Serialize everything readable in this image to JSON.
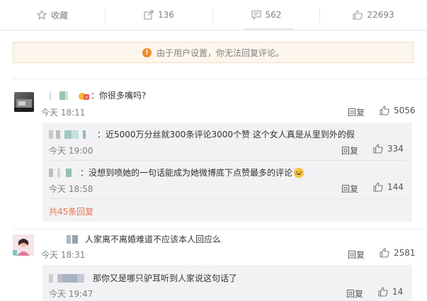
{
  "actions": {
    "favorite_label": "收藏",
    "repost_count": "136",
    "comment_count": "562",
    "like_count": "22693"
  },
  "notice": {
    "text": "由于用户设置，你无法回复评论。"
  },
  "comments": [
    {
      "text": "：你很多嘴吗?",
      "time": "今天 18:11",
      "reply_label": "回复",
      "likes": "5056",
      "replies": [
        {
          "text": "：近5000万分丝就300条评论3000个赞 这个女人真是从里到外的假",
          "time": "今天 19:00",
          "reply_label": "回复",
          "likes": "334"
        },
        {
          "text": "：没想到喷她的一句话能成为她微博底下点赞最多的评论",
          "time": "今天 18:58",
          "reply_label": "回复",
          "likes": "144"
        }
      ],
      "more_replies": "共45条回复"
    },
    {
      "text": "人家离不离婚难道不应该本人回应么",
      "time": "今天 18:31",
      "reply_label": "回复",
      "likes": "2581",
      "replies": [
        {
          "text": "那你又是哪只驴耳听到人家说这句话了",
          "time": "今天 19:47",
          "reply_label": "回复",
          "likes": "14"
        }
      ]
    }
  ],
  "colors": {
    "accent": "#eb7350",
    "warning": "#f08a24",
    "notice_bg": "#fdf6ec",
    "sub_bg": "#f2f2f5"
  }
}
